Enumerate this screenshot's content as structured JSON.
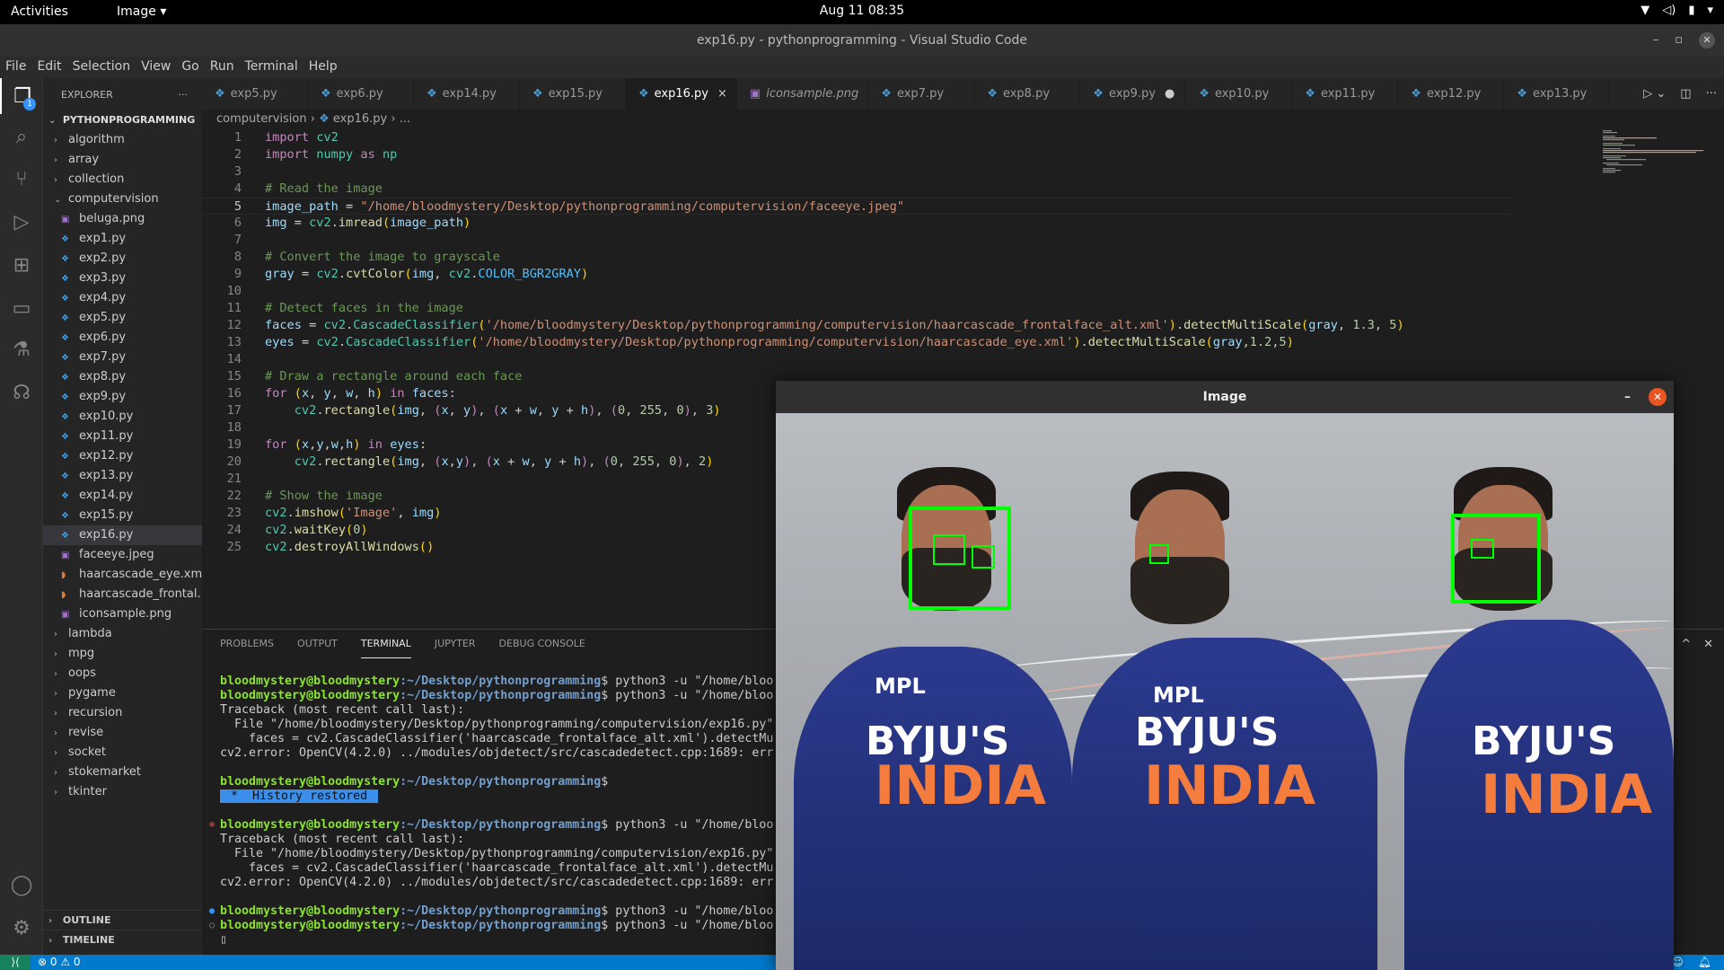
{
  "topbar": {
    "activities": "Activities",
    "app_menu": "Image",
    "clock": "Aug 11  08:35"
  },
  "window": {
    "title": "exp16.py - pythonprogramming - Visual Studio Code"
  },
  "menu": [
    "File",
    "Edit",
    "Selection",
    "View",
    "Go",
    "Run",
    "Terminal",
    "Help"
  ],
  "activity_badge": "1",
  "explorer": {
    "title": "EXPLORER",
    "root": "PYTHONPROGRAMMING",
    "items": [
      {
        "label": "algorithm",
        "kind": "folder"
      },
      {
        "label": "array",
        "kind": "folder"
      },
      {
        "label": "collection",
        "kind": "folder"
      },
      {
        "label": "computervision",
        "kind": "folder-open"
      },
      {
        "label": "beluga.png",
        "kind": "img"
      },
      {
        "label": "exp1.py",
        "kind": "py"
      },
      {
        "label": "exp2.py",
        "kind": "py"
      },
      {
        "label": "exp3.py",
        "kind": "py"
      },
      {
        "label": "exp4.py",
        "kind": "py"
      },
      {
        "label": "exp5.py",
        "kind": "py"
      },
      {
        "label": "exp6.py",
        "kind": "py"
      },
      {
        "label": "exp7.py",
        "kind": "py"
      },
      {
        "label": "exp8.py",
        "kind": "py"
      },
      {
        "label": "exp9.py",
        "kind": "py"
      },
      {
        "label": "exp10.py",
        "kind": "py"
      },
      {
        "label": "exp11.py",
        "kind": "py"
      },
      {
        "label": "exp12.py",
        "kind": "py"
      },
      {
        "label": "exp13.py",
        "kind": "py"
      },
      {
        "label": "exp14.py",
        "kind": "py"
      },
      {
        "label": "exp15.py",
        "kind": "py"
      },
      {
        "label": "exp16.py",
        "kind": "py",
        "selected": true
      },
      {
        "label": "faceeye.jpeg",
        "kind": "img"
      },
      {
        "label": "haarcascade_eye.xml",
        "kind": "xml"
      },
      {
        "label": "haarcascade_frontal...",
        "kind": "xml"
      },
      {
        "label": "iconsample.png",
        "kind": "img"
      },
      {
        "label": "lambda",
        "kind": "folder"
      },
      {
        "label": "mpg",
        "kind": "folder"
      },
      {
        "label": "oops",
        "kind": "folder"
      },
      {
        "label": "pygame",
        "kind": "folder"
      },
      {
        "label": "recursion",
        "kind": "folder"
      },
      {
        "label": "revise",
        "kind": "folder"
      },
      {
        "label": "socket",
        "kind": "folder"
      },
      {
        "label": "stokemarket",
        "kind": "folder"
      },
      {
        "label": "tkinter",
        "kind": "folder"
      }
    ],
    "outline": "OUTLINE",
    "timeline": "TIMELINE"
  },
  "tabs": [
    {
      "label": "exp5.py",
      "kind": "py"
    },
    {
      "label": "exp6.py",
      "kind": "py"
    },
    {
      "label": "exp14.py",
      "kind": "py"
    },
    {
      "label": "exp15.py",
      "kind": "py"
    },
    {
      "label": "exp16.py",
      "kind": "py",
      "active": true,
      "close": "×"
    },
    {
      "label": "iconsample.png",
      "kind": "img",
      "italic": true
    },
    {
      "label": "exp7.py",
      "kind": "py"
    },
    {
      "label": "exp8.py",
      "kind": "py"
    },
    {
      "label": "exp9.py",
      "kind": "py",
      "dot": "●"
    },
    {
      "label": "exp10.py",
      "kind": "py"
    },
    {
      "label": "exp11.py",
      "kind": "py"
    },
    {
      "label": "exp12.py",
      "kind": "py"
    },
    {
      "label": "exp13.py",
      "kind": "py"
    }
  ],
  "breadcrumb": {
    "folder": "computervision",
    "file": "exp16.py",
    "more": "..."
  },
  "code_lines": [
    {
      "n": "1",
      "html": "<span class='kw'>import</span> <span class='cl'>cv2</span>"
    },
    {
      "n": "2",
      "html": "<span class='kw'>import</span> <span class='cl'>numpy</span> <span class='kw'>as</span> <span class='cl'>np</span>"
    },
    {
      "n": "3",
      "html": ""
    },
    {
      "n": "4",
      "html": "<span class='cm'># Read the image</span>"
    },
    {
      "n": "5",
      "html": "<span class='vr'>image_path</span> <span class='df'>=</span> <span class='st'>\"/home/bloodmystery/Desktop/pythonprogramming/computervision/faceeye.jpeg\"</span>",
      "cur": true
    },
    {
      "n": "6",
      "html": "<span class='vr'>img</span> <span class='df'>=</span> <span class='cl'>cv2</span>.<span class='fn'>imread</span><span class='pu'>(</span><span class='vr'>image_path</span><span class='pu'>)</span>"
    },
    {
      "n": "7",
      "html": ""
    },
    {
      "n": "8",
      "html": "<span class='cm'># Convert the image to grayscale</span>"
    },
    {
      "n": "9",
      "html": "<span class='vr'>gray</span> <span class='df'>=</span> <span class='cl'>cv2</span>.<span class='fn'>cvtColor</span><span class='pu'>(</span><span class='vr'>img</span>, <span class='cl'>cv2</span>.<span class='cn'>COLOR_BGR2GRAY</span><span class='pu'>)</span>"
    },
    {
      "n": "10",
      "html": ""
    },
    {
      "n": "11",
      "html": "<span class='cm'># Detect faces in the image</span>"
    },
    {
      "n": "12",
      "html": "<span class='vr'>faces</span> <span class='df'>=</span> <span class='cl'>cv2</span>.<span class='cl'>CascadeClassifier</span><span class='pu'>(</span><span class='st'>'/home/bloodmystery/Desktop/pythonprogramming/computervision/haarcascade_frontalface_alt.xml'</span><span class='pu'>)</span>.<span class='fn'>detectMultiScale</span><span class='pu'>(</span><span class='vr'>gray</span>, <span class='nm'>1.3</span>, <span class='nm'>5</span><span class='pu'>)</span>"
    },
    {
      "n": "13",
      "html": "<span class='vr'>eyes</span> <span class='df'>=</span> <span class='cl'>cv2</span>.<span class='cl'>CascadeClassifier</span><span class='pu'>(</span><span class='st'>'/home/bloodmystery/Desktop/pythonprogramming/computervision/haarcascade_eye.xml'</span><span class='pu'>)</span>.<span class='fn'>detectMultiScale</span><span class='pu'>(</span><span class='vr'>gray</span>,<span class='nm'>1.2</span>,<span class='nm'>5</span><span class='pu'>)</span>"
    },
    {
      "n": "14",
      "html": ""
    },
    {
      "n": "15",
      "html": "<span class='cm'># Draw a rectangle around each face</span>"
    },
    {
      "n": "16",
      "html": "<span class='kw'>for</span> <span class='pu'>(</span><span class='vr'>x</span>, <span class='vr'>y</span>, <span class='vr'>w</span>, <span class='vr'>h</span><span class='pu'>)</span> <span class='kw'>in</span> <span class='vr'>faces</span>:"
    },
    {
      "n": "17",
      "html": "    <span class='cl'>cv2</span>.<span class='fn'>rectangle</span><span class='pu'>(</span><span class='vr'>img</span>, <span class='kw'>(</span><span class='vr'>x</span>, <span class='vr'>y</span><span class='kw'>)</span>, <span class='kw'>(</span><span class='vr'>x</span> + <span class='vr'>w</span>, <span class='vr'>y</span> + <span class='vr'>h</span><span class='kw'>)</span>, <span class='kw'>(</span><span class='nm'>0</span>, <span class='nm'>255</span>, <span class='nm'>0</span><span class='kw'>)</span>, <span class='nm'>3</span><span class='pu'>)</span>"
    },
    {
      "n": "18",
      "html": ""
    },
    {
      "n": "19",
      "html": "<span class='kw'>for</span> <span class='pu'>(</span><span class='vr'>x</span>,<span class='vr'>y</span>,<span class='vr'>w</span>,<span class='vr'>h</span><span class='pu'>)</span> <span class='kw'>in</span> <span class='vr'>eyes</span>:"
    },
    {
      "n": "20",
      "html": "    <span class='cl'>cv2</span>.<span class='fn'>rectangle</span><span class='pu'>(</span><span class='vr'>img</span>, <span class='kw'>(</span><span class='vr'>x</span>,<span class='vr'>y</span><span class='kw'>)</span>, <span class='kw'>(</span><span class='vr'>x</span> + <span class='vr'>w</span>, <span class='vr'>y</span> + <span class='vr'>h</span><span class='kw'>)</span>, <span class='kw'>(</span><span class='nm'>0</span>, <span class='nm'>255</span>, <span class='nm'>0</span><span class='kw'>)</span>, <span class='nm'>2</span><span class='pu'>)</span>"
    },
    {
      "n": "21",
      "html": ""
    },
    {
      "n": "22",
      "html": "<span class='cm'># Show the image</span>"
    },
    {
      "n": "23",
      "html": "<span class='cl'>cv2</span>.<span class='fn'>imshow</span><span class='pu'>(</span><span class='st'>'Image'</span>, <span class='vr'>img</span><span class='pu'>)</span>"
    },
    {
      "n": "24",
      "html": "<span class='cl'>cv2</span>.<span class='fn'>waitKey</span><span class='pu'>(</span><span class='nm'>0</span><span class='pu'>)</span>"
    },
    {
      "n": "25",
      "html": "<span class='cl'>cv2</span>.<span class='fn'>destroyAllWindows</span><span class='pu'>()</span>"
    }
  ],
  "panel_tabs": [
    "PROBLEMS",
    "OUTPUT",
    "TERMINAL",
    "JUPYTER",
    "DEBUG CONSOLE"
  ],
  "terminal": {
    "user": "bloodmystery@bloodmystery",
    "path": ":~/Desktop/pythonprogramming",
    "lines": [
      {
        "type": "prompt",
        "cmd": "$ python3 -u \"/home/bloo"
      },
      {
        "type": "prompt",
        "cmd": "$ python3 -u \"/home/bloo"
      },
      {
        "type": "text",
        "text": "Traceback (most recent call last):"
      },
      {
        "type": "text",
        "text": "  File \"/home/bloodmystery/Desktop/pythonprogramming/computervision/exp16.py\""
      },
      {
        "type": "text",
        "text": "    faces = cv2.CascadeClassifier('haarcascade_frontalface_alt.xml').detectMu"
      },
      {
        "type": "text",
        "text": "cv2.error: OpenCV(4.2.0) ../modules/objdetect/src/cascadedetect.cpp:1689: err"
      },
      {
        "type": "blank"
      },
      {
        "type": "prompt",
        "cmd": "$"
      },
      {
        "type": "hist",
        "text": " *  History restored "
      },
      {
        "type": "blank"
      },
      {
        "type": "prompt",
        "cmd": "$ python3 -u \"/home/bloo",
        "mark": "⊗"
      },
      {
        "type": "text",
        "text": "Traceback (most recent call last):"
      },
      {
        "type": "text",
        "text": "  File \"/home/bloodmystery/Desktop/pythonprogramming/computervision/exp16.py\""
      },
      {
        "type": "text",
        "text": "    faces = cv2.CascadeClassifier('haarcascade_frontalface_alt.xml').detectMu"
      },
      {
        "type": "text",
        "text": "cv2.error: OpenCV(4.2.0) ../modules/objdetect/src/cascadedetect.cpp:1689: err"
      },
      {
        "type": "blank"
      },
      {
        "type": "prompt",
        "cmd": "$ python3 -u \"/home/bloo",
        "mark": "●"
      },
      {
        "type": "prompt",
        "cmd": "$ python3 -u \"/home/bloo",
        "mark": "○"
      },
      {
        "type": "text",
        "text": "▯"
      }
    ]
  },
  "status": {
    "remote": "⟩⟨",
    "errors": "⊗ 0 ⚠ 0"
  },
  "image_window": {
    "title": "Image",
    "jersey_sponsor": "MPL",
    "jersey_brand": "BYJU'S",
    "jersey_country": "INDIA"
  }
}
